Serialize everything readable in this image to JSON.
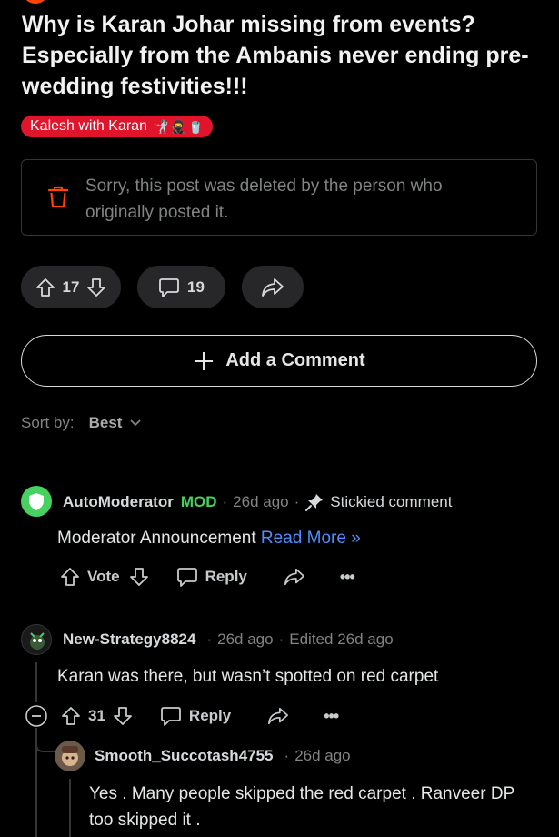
{
  "post": {
    "title": "Why is Karan Johar missing from events? Especially from the Ambanis never ending pre-wedding festivities!!!",
    "flair": {
      "label": "Kalesh with Karan",
      "emojis": [
        "🤺",
        "🥷",
        "🥤"
      ],
      "color": "#e0152b"
    },
    "deleted_message": "Sorry, this post was deleted by the person who originally posted it.",
    "votes": "17",
    "comments": "19"
  },
  "add_comment_label": "Add a Comment",
  "sort": {
    "label": "Sort by:",
    "value": "Best"
  },
  "comments": [
    {
      "user": "AutoModerator",
      "badge": "MOD",
      "age": "26d ago",
      "extra": "Stickied comment",
      "body": "Moderator Announcement",
      "link": "Read More »",
      "vote_label": "Vote",
      "reply_label": "Reply"
    },
    {
      "user": "New-Strategy8824",
      "age": "26d ago",
      "extra": "Edited 26d ago",
      "body": "Karan was there, but wasn’t spotted on red carpet",
      "votes": "31",
      "reply_label": "Reply"
    },
    {
      "user": "Smooth_Succotash4755",
      "age": "26d ago",
      "body": "Yes . Many people skipped the red carpet . Ranveer DP too skipped it ."
    }
  ],
  "colors": {
    "background": "#000000",
    "mod": "#46d160",
    "link": "#4f8dff",
    "pill": "#272729",
    "deleted_icon": "#ff4500"
  }
}
